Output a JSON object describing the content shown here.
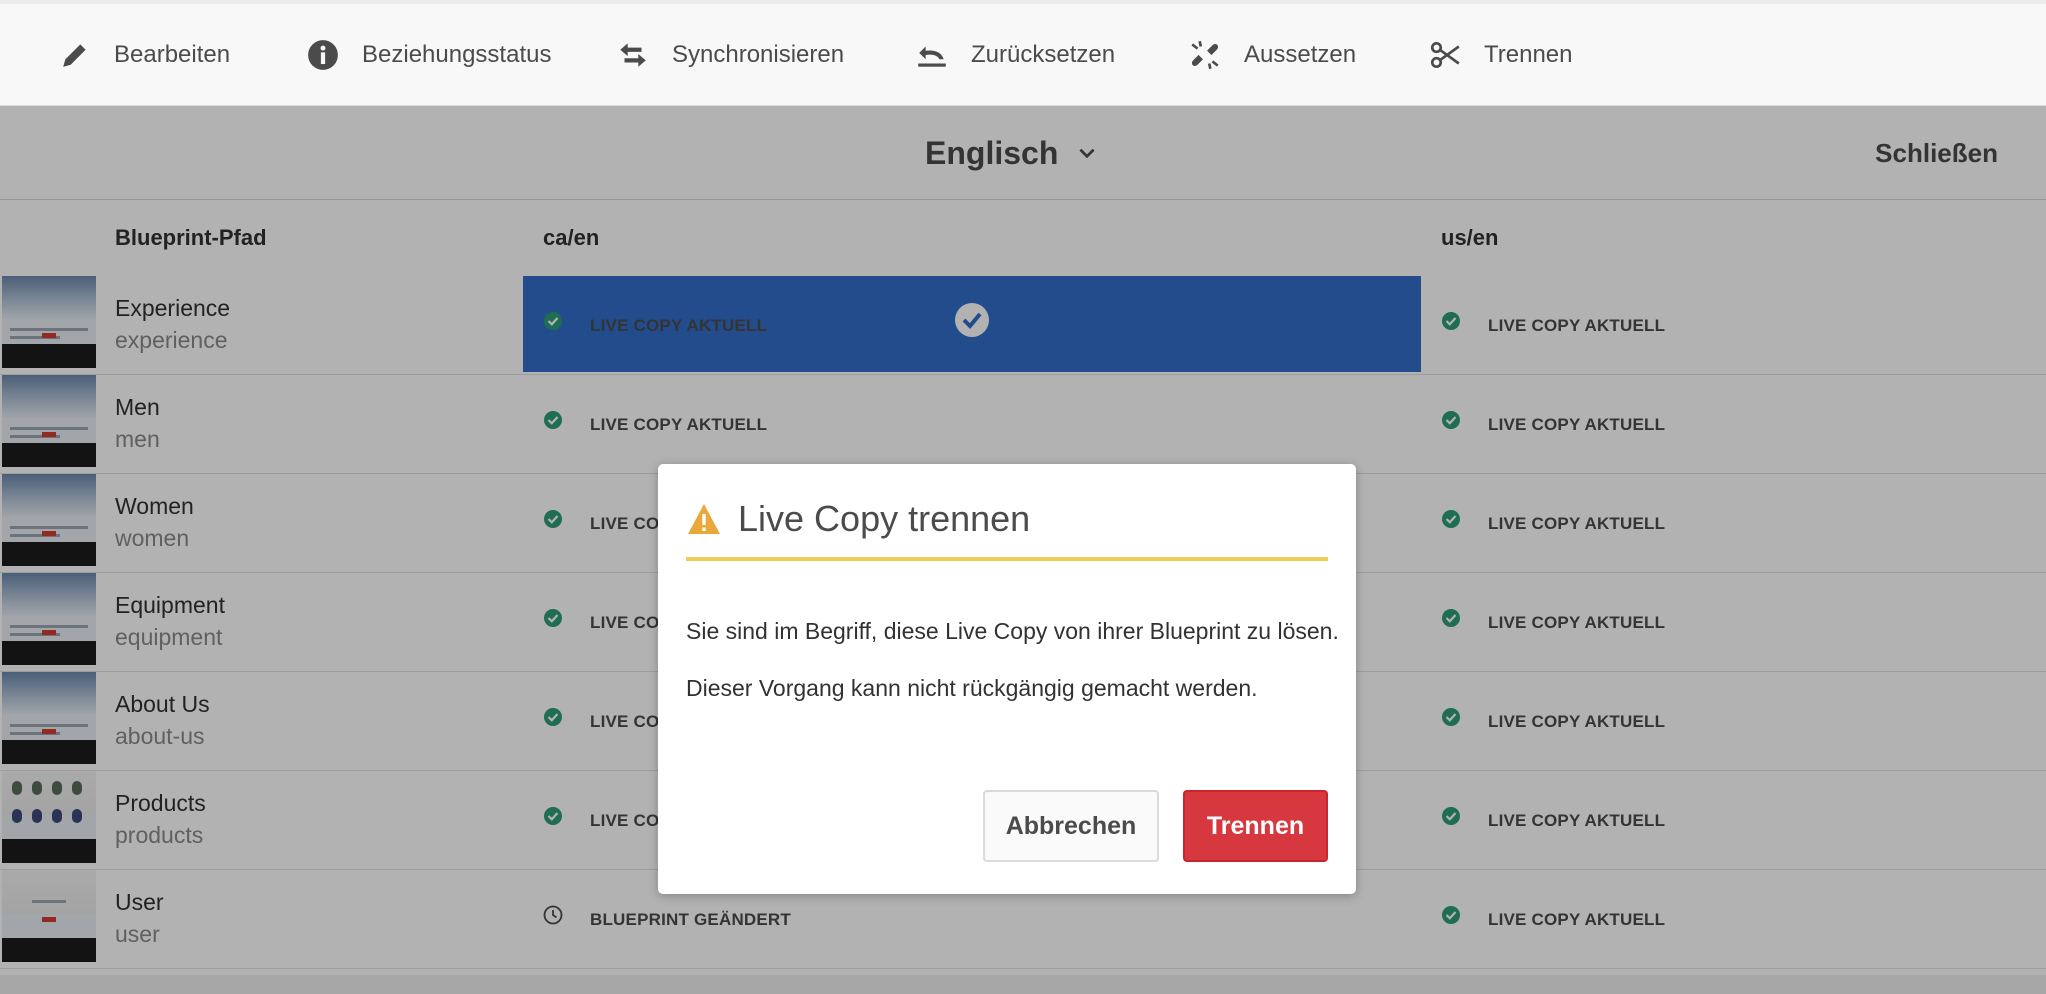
{
  "toolbar": {
    "items": [
      {
        "label": "Bearbeiten",
        "icon": "pencil-icon"
      },
      {
        "label": "Beziehungsstatus",
        "icon": "info-icon"
      },
      {
        "label": "Synchronisieren",
        "icon": "sync-arrows-icon"
      },
      {
        "label": "Zurücksetzen",
        "icon": "undo-icon"
      },
      {
        "label": "Aussetzen",
        "icon": "broken-link-icon"
      },
      {
        "label": "Trennen",
        "icon": "scissors-icon"
      }
    ]
  },
  "language_bar": {
    "selected_language": "Englisch",
    "close_label": "Schließen"
  },
  "table": {
    "columns": [
      "Blueprint-Pfad",
      "ca/en",
      "us/en"
    ],
    "rows": [
      {
        "title": "Experience",
        "name": "experience",
        "ca_en": "LIVE COPY AKTUELL",
        "us_en": "LIVE COPY AKTUELL",
        "selected_ca_en": true
      },
      {
        "title": "Men",
        "name": "men",
        "ca_en": "LIVE COPY AKTUELL",
        "us_en": "LIVE COPY AKTUELL"
      },
      {
        "title": "Women",
        "name": "women",
        "ca_en": "LIVE CO",
        "us_en": "LIVE COPY AKTUELL"
      },
      {
        "title": "Equipment",
        "name": "equipment",
        "ca_en": "LIVE CO",
        "us_en": "LIVE COPY AKTUELL"
      },
      {
        "title": "About Us",
        "name": "about-us",
        "ca_en": "LIVE CO",
        "us_en": "LIVE COPY AKTUELL"
      },
      {
        "title": "Products",
        "name": "products",
        "ca_en": "LIVE CO",
        "us_en": "LIVE COPY AKTUELL"
      },
      {
        "title": "User",
        "name": "user",
        "ca_en": "BLUEPRINT GEÄNDERT",
        "us_en": "LIVE COPY AKTUELL"
      }
    ]
  },
  "dialog": {
    "title": "Live Copy trennen",
    "message_1": "Sie sind im Begriff, diese Live Copy von ihrer Blueprint zu lösen.",
    "message_2": "Dieser Vorgang kann nicht rückgängig gemacht werden.",
    "cancel_label": "Abbrechen",
    "confirm_label": "Trennen"
  },
  "colors": {
    "status_ok": "#2d9d78",
    "selected_cell": "#326ec8",
    "warning": "#e8a83a",
    "warning_rule": "#f2cc58",
    "danger_button": "#d7373f"
  }
}
